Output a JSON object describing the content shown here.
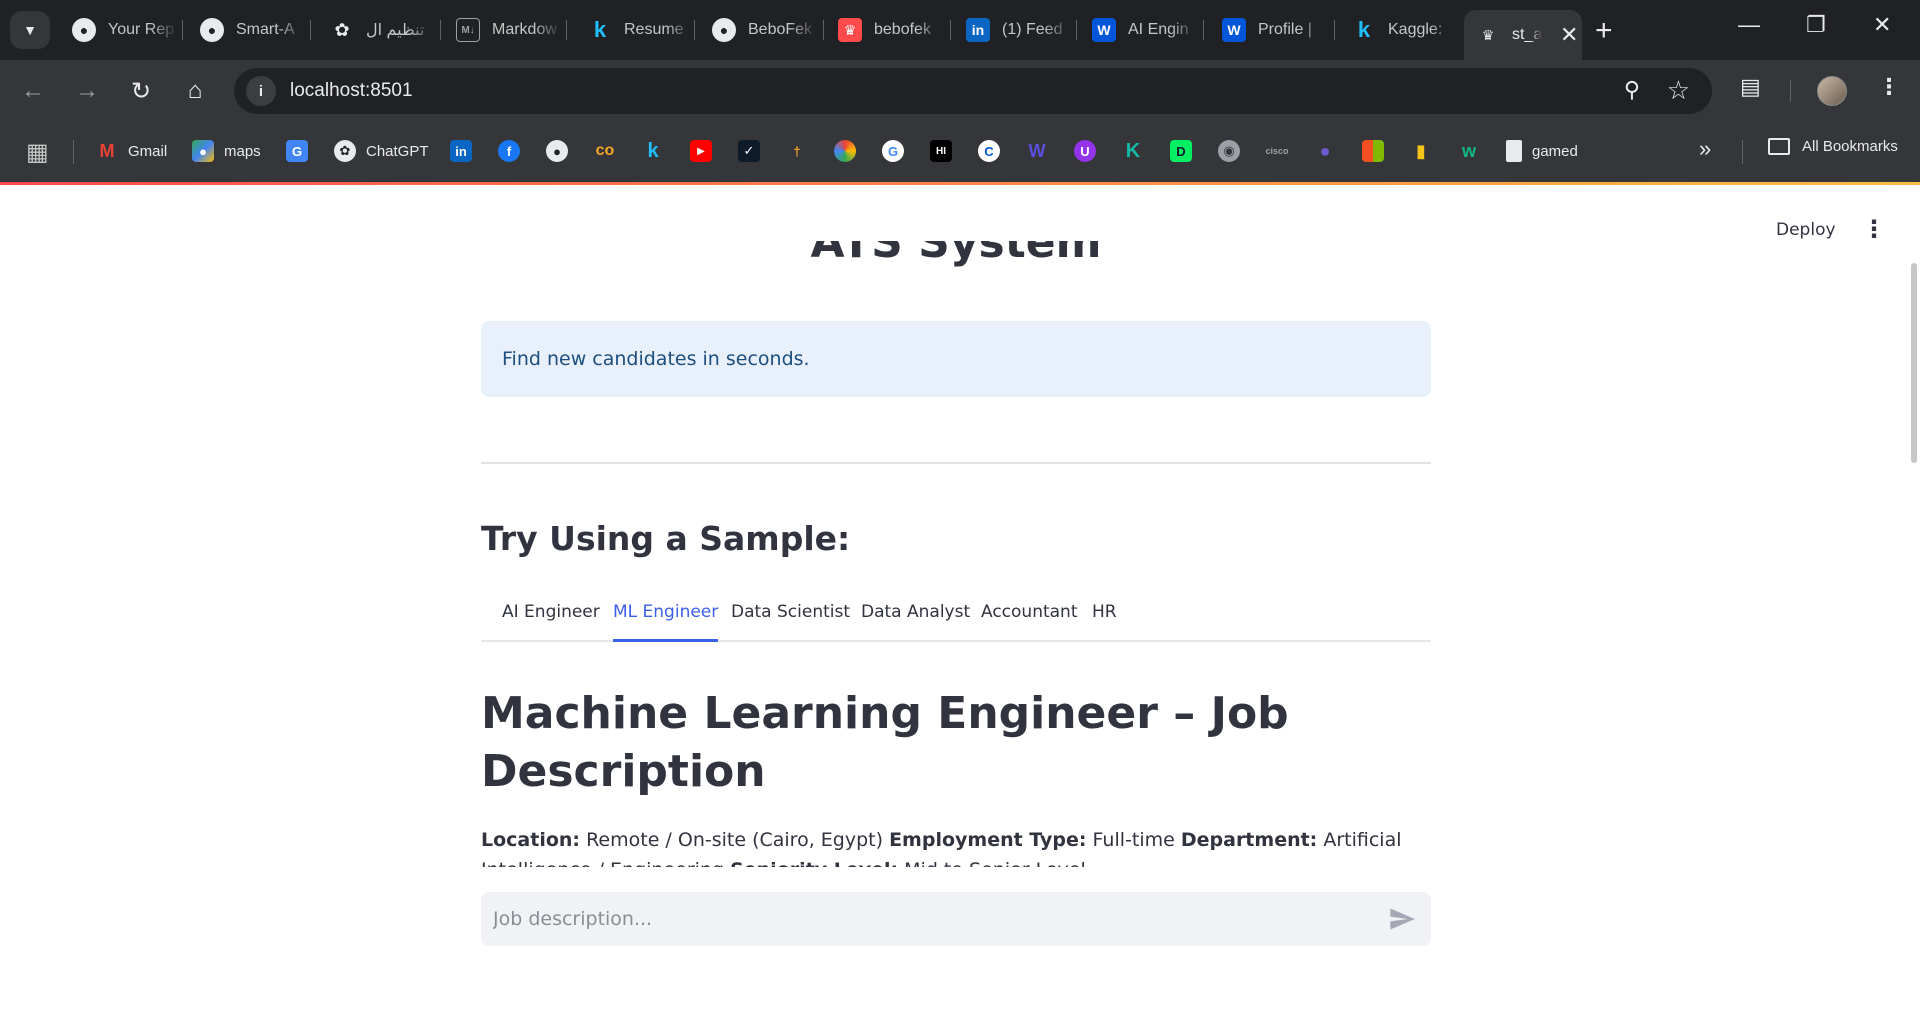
{
  "browser": {
    "tabs": [
      {
        "title": "Your Rep",
        "icon": "github-icon"
      },
      {
        "title": "Smart-A",
        "icon": "github-icon"
      },
      {
        "title": "تنظيم ال",
        "icon": "chatgpt-icon"
      },
      {
        "title": "Markdow",
        "icon": "markdown-icon"
      },
      {
        "title": "Resume",
        "icon": "kaggle-icon"
      },
      {
        "title": "BeboFek",
        "icon": "github-icon"
      },
      {
        "title": "bebofek",
        "icon": "streamlit-icon"
      },
      {
        "title": "(1) Feed",
        "icon": "linkedin-icon"
      },
      {
        "title": "AI Engin",
        "icon": "wuzzuf-icon"
      },
      {
        "title": "Profile |",
        "icon": "wuzzuf-icon"
      },
      {
        "title": "Kaggle:",
        "icon": "kaggle-icon"
      },
      {
        "title": "st_a",
        "icon": "streamlit-icon",
        "active": true
      }
    ],
    "url": "localhost:8501",
    "bookmarks": [
      {
        "label": "Gmail",
        "icon": "gmail-icon"
      },
      {
        "label": "maps",
        "icon": "maps-icon"
      },
      {
        "label": "",
        "icon": "google-translate-icon"
      },
      {
        "label": "ChatGPT",
        "icon": "chatgpt-icon"
      },
      {
        "label": "",
        "icon": "linkedin-icon"
      },
      {
        "label": "",
        "icon": "facebook-icon"
      },
      {
        "label": "",
        "icon": "github-icon"
      },
      {
        "label": "",
        "icon": "coursera-icon"
      },
      {
        "label": "",
        "icon": "kaggle-icon"
      },
      {
        "label": "",
        "icon": "youtube-icon"
      },
      {
        "label": "gamed",
        "icon": "file-icon"
      }
    ],
    "all_bookmarks_label": "All Bookmarks"
  },
  "app": {
    "deploy_label": "Deploy",
    "title": "ATS System",
    "info_text": "Find new candidates in seconds.",
    "sample_heading": "Try Using a Sample:",
    "tabs": [
      "AI Engineer",
      "ML Engineer",
      "Data Scientist",
      "Data Analyst",
      "Accountant",
      "HR"
    ],
    "active_tab": "ML Engineer",
    "job": {
      "title": "Machine Learning Engineer – Job Description",
      "location_label": "Location:",
      "location_value": "Remote / On-site (Cairo, Egypt)",
      "employment_label": "Employment Type:",
      "employment_value": "Full-time",
      "department_label": "Department:",
      "department_value": "Artificial Intelligence / Engineering",
      "seniority_label": "Seniority Level:",
      "seniority_value": "Mid to Senior Level"
    },
    "chat_input": {
      "placeholder": "Job description...",
      "value": ""
    }
  },
  "colors": {
    "accent_tab": "#3b5fe6",
    "info_bg": "#e8f1fb",
    "info_text": "#1c4e80",
    "chrome_dark": "#202124",
    "chrome_toolbar": "#35363a"
  }
}
